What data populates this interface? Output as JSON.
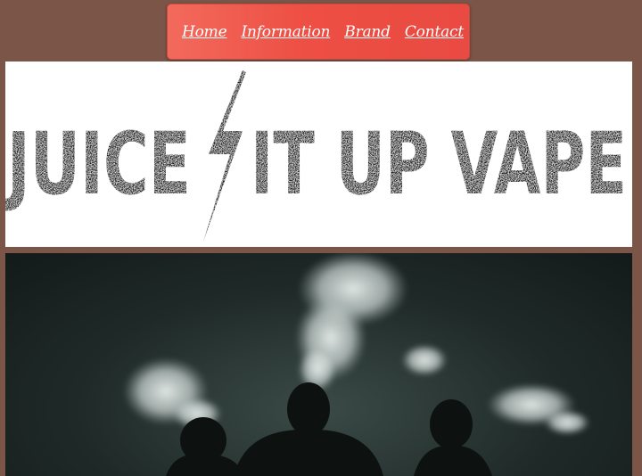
{
  "nav": {
    "items": [
      {
        "label": "Home"
      },
      {
        "label": "Information"
      },
      {
        "label": "Brand"
      },
      {
        "label": "Contact"
      }
    ]
  },
  "banner": {
    "logo_text_left": "JUICE",
    "logo_text_right": "IT UP VAPE"
  },
  "photo": {
    "description_icon": "vape-smoke-photo"
  },
  "colors": {
    "page_background": "#7a5548",
    "nav_background": "#ee5145",
    "logo_ink": "#1a1a1a"
  }
}
